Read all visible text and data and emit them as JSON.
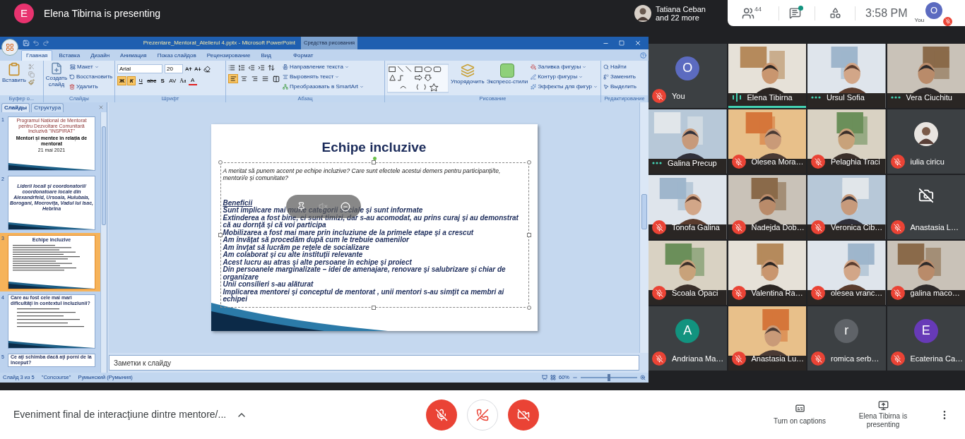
{
  "header": {
    "presenter_initial": "E",
    "presenter_text": "Elena Tibirna is presenting",
    "others_line1": "Tatiana Ceban",
    "others_line2": "and 22 more",
    "people_count": "44",
    "chat_unread": true,
    "time": "3:58 PM",
    "self_label": "You",
    "self_initial": "O",
    "self_muted": true
  },
  "powerpoint": {
    "title": "Prezentare_Mentorat_Atelierul 4.pptx - Microsoft PowerPoint",
    "contextual_tab": "Средства рисования",
    "tabs": [
      {
        "label": "Главная",
        "selected": true
      },
      {
        "label": "Вставка",
        "selected": false
      },
      {
        "label": "Дизайн",
        "selected": false
      },
      {
        "label": "Анимация",
        "selected": false
      },
      {
        "label": "Показ слайдов",
        "selected": false
      },
      {
        "label": "Рецензирование",
        "selected": false
      },
      {
        "label": "Вид",
        "selected": false
      },
      {
        "label": "Формат",
        "selected": false
      }
    ],
    "clipboard": {
      "label": "Буфер о...",
      "paste": "Вставить"
    },
    "slides_group": {
      "label": "Слайды",
      "new_slide": "Создать слайд",
      "layout": "Макет",
      "reset": "Восстановить",
      "delete": "Удалить"
    },
    "font_group": {
      "label": "Шрифт",
      "font": "Arial",
      "size": "20",
      "format_buttons": [
        {
          "text": "Ж",
          "kind": "bold",
          "selected": true
        },
        {
          "text": "К",
          "kind": "italic",
          "selected": true
        },
        {
          "text": "Ч",
          "kind": "underline",
          "selected": false
        },
        {
          "text": "abc",
          "kind": "strike",
          "selected": false
        },
        {
          "text": "S",
          "kind": "shadow",
          "selected": false
        },
        {
          "text": "AV",
          "kind": "spacing",
          "selected": false
        },
        {
          "text": "Aa",
          "kind": "case",
          "selected": false
        },
        {
          "text": "A",
          "kind": "color",
          "selected": false
        }
      ]
    },
    "paragraph_group": {
      "label": "Абзац",
      "align_buttons": [
        {
          "kind": "left",
          "selected": true
        },
        {
          "kind": "center",
          "selected": false
        },
        {
          "kind": "right",
          "selected": false
        },
        {
          "kind": "justify",
          "selected": false
        }
      ],
      "commands": [
        "Направление текста",
        "Выровнять текст",
        "Преобразовать в SmartArt"
      ]
    },
    "drawing_group": {
      "label": "Рисование",
      "arrange": "Упорядочить",
      "quick_styles": "Экспресс-стили",
      "commands": [
        "Заливка фигуры",
        "Контур фигуры",
        "Эффекты для фигур"
      ]
    },
    "editing_group": {
      "label": "Редактирование",
      "commands": [
        "Найти",
        "Заменить",
        "Выделить"
      ]
    },
    "panel_tabs": [
      {
        "label": "Слайды",
        "selected": true
      },
      {
        "label": "Структура",
        "selected": false
      }
    ],
    "thumbnails": [
      {
        "number": "1",
        "selected": false,
        "kind": "title",
        "header": "Programul Național de Mentorat pentru Dezvoltare Comunitară Incluzivă \"INSPIRAT\"",
        "title": "Mentori și mentee în relația de mentorat",
        "date": "21 mai 2021"
      },
      {
        "number": "2",
        "selected": false,
        "kind": "text",
        "body": "Liderii locali și coordonatorii/ coordonatoare locale din Alexandrfeld, Ursoaia, Hulubaia, Borogani, Mocrovița, Vadul lui Isac, Hebrina"
      },
      {
        "number": "3",
        "selected": true,
        "kind": "list",
        "title": "Echipe incluzive"
      },
      {
        "number": "4",
        "selected": false,
        "kind": "bullets",
        "title": "Care au fost cele mai mari dificultăţi în contextul incluziunii?"
      },
      {
        "number": "5",
        "selected": false,
        "kind": "partial",
        "title": "Ce aţi schimba dacă aţi porni de la început?"
      }
    ],
    "slide": {
      "title": "Echipe incluzive",
      "question": "A meritat să punem accent pe echipe  incluzive? Care sunt efectele acestui demers pentru participanți/te, mentori/e și comunitate?",
      "heading": "Beneficii",
      "lines": [
        "Sunt implicare mai multe categorii sociale şi sunt informate",
        "Extinderea a fost bine, ei sunt timizi, dar s-au acomodat, au prins curaj şi au demonstrat că au dornţă şi că voi participa",
        "Mobilizarea a fost mai mare prin incluziune de la primele etape şi a crescut",
        "Am învăţat să procedăm după cum le trebuie oamenilor",
        "Am învţat să lucrăm pe reţele de socializare",
        "Am colaborat şi cu alte instituţii relevante",
        "Acest lucru au atras şi alte persoane în echipe şi proiect",
        "Din persoanele marginalizate – idei de amenajare, renovare şi salubrizare şi chiar de organizare",
        "Unii consilieri s-au alăturat",
        "Implicarea mentorei şi conceptul de mentorat , unii mentori s-au simţit ca membri ai echipei"
      ]
    },
    "notes_placeholder": "Заметки к слайду",
    "status": {
      "slide": "Слайд 3 из 5",
      "theme": "\"Concourse\"",
      "language": "Румынский (Румыния)",
      "zoom": "60%",
      "zoom_slider": {
        "level": 0.5
      }
    }
  },
  "tiles": [
    {
      "name": "You",
      "kind": "avatar",
      "initial": "O",
      "color": "#5c6bc0",
      "muted": true,
      "speaking": false
    },
    {
      "name": "Elena Tibirna",
      "kind": "video",
      "muted": false,
      "speaking": true
    },
    {
      "name": "Ursul Sofia",
      "kind": "video",
      "muted": false,
      "speaking": false
    },
    {
      "name": "Vera Ciuchitu",
      "kind": "video",
      "muted": false,
      "speaking": false
    },
    {
      "name": "Galina Precup",
      "kind": "video",
      "muted": false,
      "speaking": false
    },
    {
      "name": "Olesea Mora…",
      "kind": "video",
      "muted": true,
      "speaking": false
    },
    {
      "name": "Pelaghia Traci",
      "kind": "video",
      "muted": true,
      "speaking": false
    },
    {
      "name": "iulia ciricu",
      "kind": "photo_avatar",
      "muted": true,
      "speaking": false
    },
    {
      "name": "Tonofa Galina",
      "kind": "video",
      "muted": true,
      "speaking": false
    },
    {
      "name": "Nadejda Dob…",
      "kind": "video",
      "muted": true,
      "speaking": false
    },
    {
      "name": "Veronica Cib…",
      "kind": "video",
      "muted": true,
      "speaking": false
    },
    {
      "name": "Anastasia L…",
      "kind": "camera_off",
      "muted": true,
      "speaking": false
    },
    {
      "name": "Scoala Opaci",
      "kind": "video",
      "muted": true,
      "speaking": false
    },
    {
      "name": "Valentina Ra…",
      "kind": "video",
      "muted": true,
      "speaking": false
    },
    {
      "name": "olesea vranc…",
      "kind": "video",
      "muted": true,
      "speaking": false
    },
    {
      "name": "galina maco…",
      "kind": "video",
      "muted": true,
      "speaking": false
    },
    {
      "name": "Andriana Ma…",
      "kind": "avatar",
      "initial": "A",
      "color": "#12937f",
      "muted": true,
      "speaking": false
    },
    {
      "name": "Anastasia Lu…",
      "kind": "video",
      "muted": true,
      "speaking": false
    },
    {
      "name": "romica serb…",
      "kind": "avatar",
      "initial": "r",
      "color": "#5f6368",
      "muted": true,
      "speaking": false
    },
    {
      "name": "Ecaterina Ca…",
      "kind": "avatar",
      "initial": "E",
      "color": "#673ab7",
      "muted": true,
      "speaking": false
    }
  ],
  "bottom_bar": {
    "meeting_title": "Eveniment final de interacţiune dintre mentore/...",
    "mic_on": false,
    "camera_on": false,
    "captions": "Turn on captions",
    "presenting": "Elena Tibirna is presenting"
  }
}
